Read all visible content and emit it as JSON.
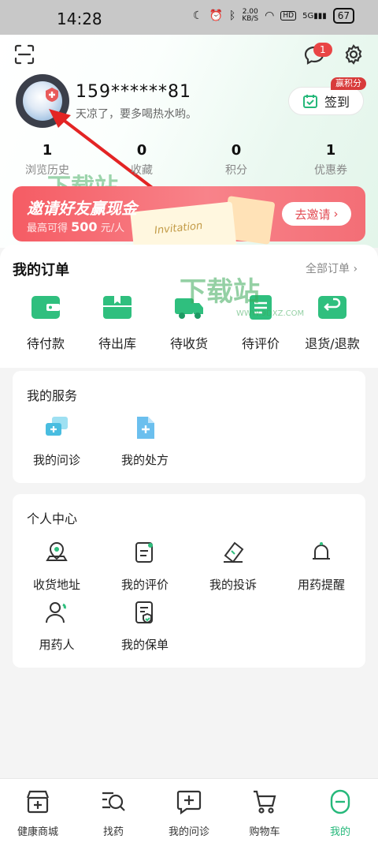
{
  "status_bar": {
    "time": "14:28",
    "speed_value": "2.00",
    "speed_unit": "KB/S",
    "hd": "HD",
    "signal": "5G",
    "battery": "67"
  },
  "header": {
    "message_badge": "1",
    "username": "159******81",
    "greeting": "天凉了，要多喝热水哟。",
    "checkin_label": "签到",
    "checkin_badge": "赢积分"
  },
  "stats": [
    {
      "value": "1",
      "label": "浏览历史"
    },
    {
      "value": "0",
      "label": "收藏"
    },
    {
      "value": "0",
      "label": "积分"
    },
    {
      "value": "1",
      "label": "优惠券"
    }
  ],
  "banner": {
    "title": "邀请好友赢现金",
    "sub_prefix": "最高可得",
    "sub_amount": "500",
    "sub_suffix": "元/人",
    "card_text": "Invitation",
    "button": "去邀请"
  },
  "orders": {
    "title": "我的订单",
    "all_link": "全部订单",
    "items": [
      "待付款",
      "待出库",
      "待收货",
      "待评价",
      "退货/退款"
    ]
  },
  "services": {
    "title": "我的服务",
    "items": [
      "我的问诊",
      "我的处方"
    ]
  },
  "personal": {
    "title": "个人中心",
    "items": [
      "收货地址",
      "我的评价",
      "我的投诉",
      "用药提醒",
      "用药人",
      "我的保单"
    ]
  },
  "watermark": {
    "text": "下载站",
    "sub": "WWW.9DXZ.COM"
  },
  "nav": {
    "items": [
      "健康商城",
      "找药",
      "我的问诊",
      "购物车",
      "我的"
    ],
    "active_index": 4
  },
  "colors": {
    "accent": "#25b87a",
    "banner": "#f55c64",
    "badge": "#e94545"
  }
}
